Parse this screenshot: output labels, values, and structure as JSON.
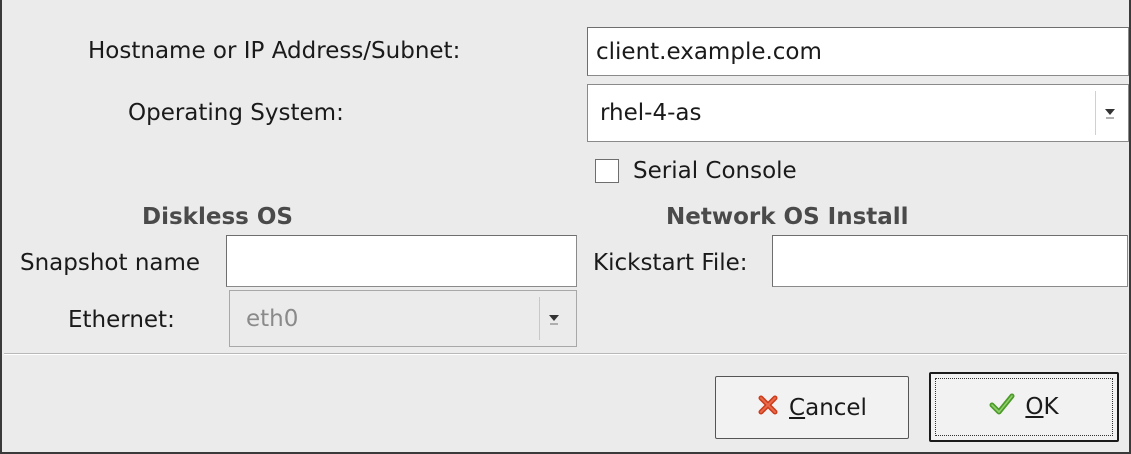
{
  "form": {
    "hostname_label": "Hostname or IP Address/Subnet:",
    "hostname_value": "client.example.com",
    "os_label": "Operating System:",
    "os_value": "rhel-4-as",
    "serial_console_label": "Serial Console",
    "serial_console_checked": false
  },
  "diskless": {
    "heading": "Diskless OS",
    "snapshot_label": "Snapshot name",
    "snapshot_value": "",
    "ethernet_label": "Ethernet:",
    "ethernet_value": "eth0",
    "ethernet_disabled": true
  },
  "network_install": {
    "heading": "Network OS Install",
    "kickstart_label": "Kickstart File:",
    "kickstart_value": ""
  },
  "buttons": {
    "cancel_mnemonic": "C",
    "cancel_rest": "ancel",
    "ok_mnemonic": "O",
    "ok_rest": "K"
  },
  "icons": {
    "dropdown": "chevron-down-icon",
    "cancel": "red-x-icon",
    "ok": "green-check-icon"
  },
  "colors": {
    "cancel_icon": "#cc3b1a",
    "ok_icon": "#4c9a2a",
    "dialog_bg": "#ebebeb"
  }
}
